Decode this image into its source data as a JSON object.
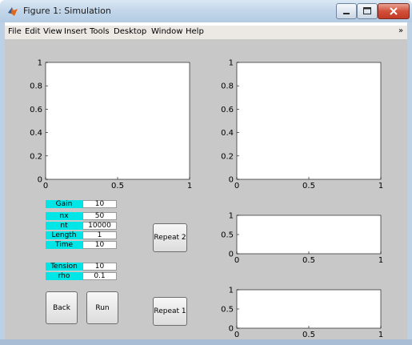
{
  "window": {
    "title": "Figure 1: Simulation"
  },
  "menu": {
    "items": [
      {
        "key": "file",
        "label": "File"
      },
      {
        "key": "edit",
        "label": "Edit"
      },
      {
        "key": "view",
        "label": "View"
      },
      {
        "key": "insert",
        "label": "Insert"
      },
      {
        "key": "tools",
        "label": "Tools"
      },
      {
        "key": "desktop",
        "label": "Desktop"
      },
      {
        "key": "window",
        "label": "Window"
      },
      {
        "key": "help",
        "label": "Help"
      }
    ],
    "overflow": "»"
  },
  "params": {
    "gain": {
      "label": "Gain",
      "value": "10"
    },
    "nx": {
      "label": "nx",
      "value": "50"
    },
    "nt": {
      "label": "nt",
      "value": "10000"
    },
    "length": {
      "label": "Length",
      "value": "1"
    },
    "time": {
      "label": "Time",
      "value": "10"
    },
    "tension": {
      "label": "Tension",
      "value": "10"
    },
    "rho": {
      "label": "rho",
      "value": "0.1"
    }
  },
  "buttons": {
    "repeat2": "Repeat 2",
    "repeat1": "Repeat 1",
    "back": "Back",
    "run": "Run"
  },
  "chart_data": [
    {
      "id": "axes-top-left",
      "type": "line",
      "series": [],
      "xlim": [
        0,
        1
      ],
      "ylim": [
        0,
        1
      ],
      "xticks": [
        "0",
        "0.5",
        "1"
      ],
      "yticks": [
        "0",
        "0.2",
        "0.4",
        "0.6",
        "0.8",
        "1"
      ],
      "grid": false
    },
    {
      "id": "axes-top-right",
      "type": "line",
      "series": [],
      "xlim": [
        0,
        1
      ],
      "ylim": [
        0,
        1
      ],
      "xticks": [
        "0",
        "0.5",
        "1"
      ],
      "yticks": [
        "0",
        "0.2",
        "0.4",
        "0.6",
        "0.8",
        "1"
      ],
      "grid": false
    },
    {
      "id": "axes-mid-right",
      "type": "line",
      "series": [],
      "xlim": [
        0,
        1
      ],
      "ylim": [
        0,
        1
      ],
      "xticks": [
        "0",
        "0.5",
        "1"
      ],
      "yticks": [
        "0",
        "0.5",
        "1"
      ],
      "grid": false
    },
    {
      "id": "axes-bottom-right",
      "type": "line",
      "series": [],
      "xlim": [
        0,
        1
      ],
      "ylim": [
        0,
        1
      ],
      "xticks": [
        "0",
        "0.5",
        "1"
      ],
      "yticks": [
        "0",
        "0.5",
        "1"
      ],
      "grid": false
    }
  ],
  "colors": {
    "figure_bg": "#c8c8c8",
    "param_label_bg": "#00e5e5",
    "axes_bg": "#ffffff",
    "titlebar": "#c4d7ea",
    "close_button": "#c94a35"
  },
  "icons": {
    "app": "matlab-icon",
    "minimize": "minimize-icon",
    "maximize": "maximize-icon",
    "close": "close-icon"
  }
}
